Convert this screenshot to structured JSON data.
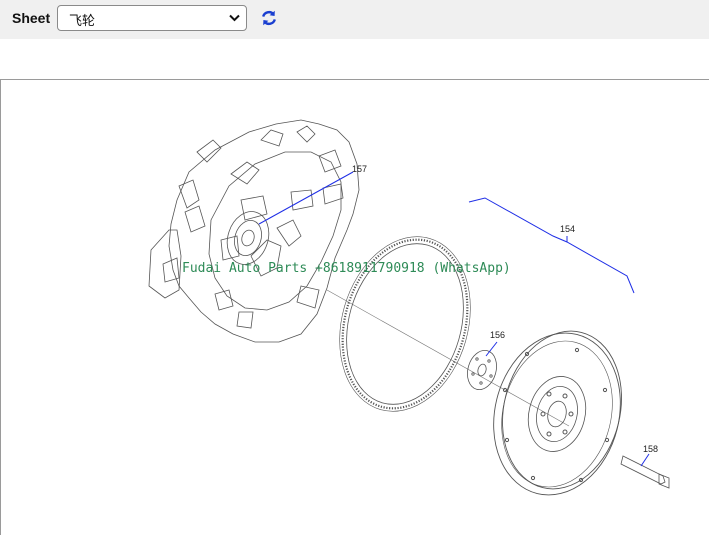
{
  "toolbar": {
    "sheet_label": "Sheet",
    "sheet_select": {
      "selected": "飞轮"
    },
    "refresh_icon": "refresh-icon",
    "accent_color": "#1a3fd0"
  },
  "diagram": {
    "callouts": [
      "157",
      "154",
      "156",
      "158"
    ],
    "watermark": "Fudai Auto Parts +8618911790918 (WhatsApp)",
    "callout_line_color": "#1e2ee6"
  }
}
